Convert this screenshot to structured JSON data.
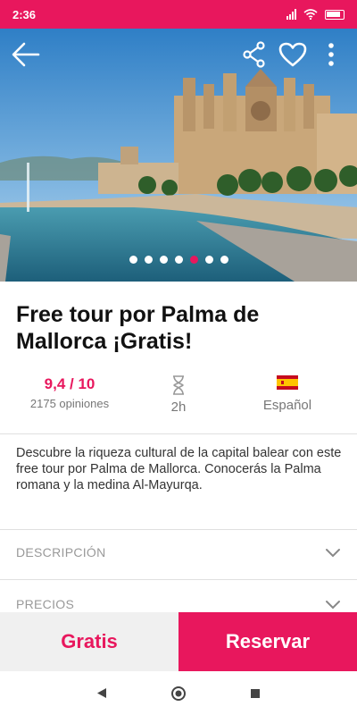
{
  "status_bar": {
    "time": "2:36",
    "color": "#e8175d"
  },
  "hero": {
    "back_icon": "arrow-left-icon",
    "share_icon": "share-icon",
    "favorite_icon": "heart-outline-icon",
    "more_icon": "more-vertical-icon",
    "image_description": "Palma de Mallorca cathedral",
    "carousel": {
      "count": 7,
      "active_index": 4
    }
  },
  "tour": {
    "title": "Free tour por Palma de Mallorca ¡Gratis!",
    "rating": "9,4 / 10",
    "reviews": "2175 opiniones",
    "duration": "2h",
    "duration_icon": "hourglass-icon",
    "language": "Español",
    "language_icon": "spain-flag-icon",
    "description": "Descubre la riqueza cultural de la capital balear con este free tour por Palma de Mallorca. Conocerás la Palma romana y la medina Al-Mayurqa."
  },
  "sections": [
    {
      "label": "DESCRIPCIÓN",
      "icon": "chevron-down-icon"
    },
    {
      "label": "PRECIOS",
      "icon": "chevron-down-icon"
    }
  ],
  "footer": {
    "price": "Gratis",
    "reserve_label": "Reservar"
  },
  "colors": {
    "accent": "#e8175d",
    "price_bg": "#f0f0f0"
  }
}
